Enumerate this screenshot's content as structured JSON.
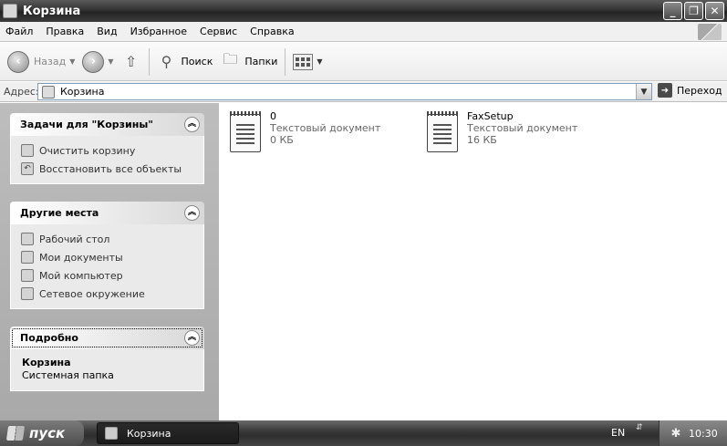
{
  "window": {
    "title": "Корзина",
    "controls": {
      "minimize": "_",
      "maximize": "❐",
      "close": "✕"
    }
  },
  "menu": [
    "Файл",
    "Правка",
    "Вид",
    "Избранное",
    "Сервис",
    "Справка"
  ],
  "toolbar": {
    "back_label": "Назад",
    "search_label": "Поиск",
    "folders_label": "Папки"
  },
  "address": {
    "label": "Адрес:",
    "value": "Корзина",
    "go_label": "Переход"
  },
  "tasks_panel": {
    "title": "Задачи для \"Корзины\"",
    "items": [
      {
        "label": "Очистить корзину",
        "icon": "empty-bin-icon"
      },
      {
        "label": "Восстановить все объекты",
        "icon": "restore-icon"
      }
    ]
  },
  "places_panel": {
    "title": "Другие места",
    "items": [
      {
        "label": "Рабочий стол",
        "icon": "desktop-icon"
      },
      {
        "label": "Мои документы",
        "icon": "documents-icon"
      },
      {
        "label": "Мой компьютер",
        "icon": "computer-icon"
      },
      {
        "label": "Сетевое окружение",
        "icon": "network-icon"
      }
    ]
  },
  "details_panel": {
    "title": "Подробно",
    "name": "Корзина",
    "type": "Системная папка"
  },
  "files": [
    {
      "name": "0",
      "type": "Текстовый документ",
      "size": "0 КБ"
    },
    {
      "name": "FaxSetup",
      "type": "Текстовый документ",
      "size": "16 КБ"
    }
  ],
  "taskbar": {
    "start_label": "пуск",
    "window_button": "Корзина",
    "language": "EN",
    "clock": "10:30"
  }
}
